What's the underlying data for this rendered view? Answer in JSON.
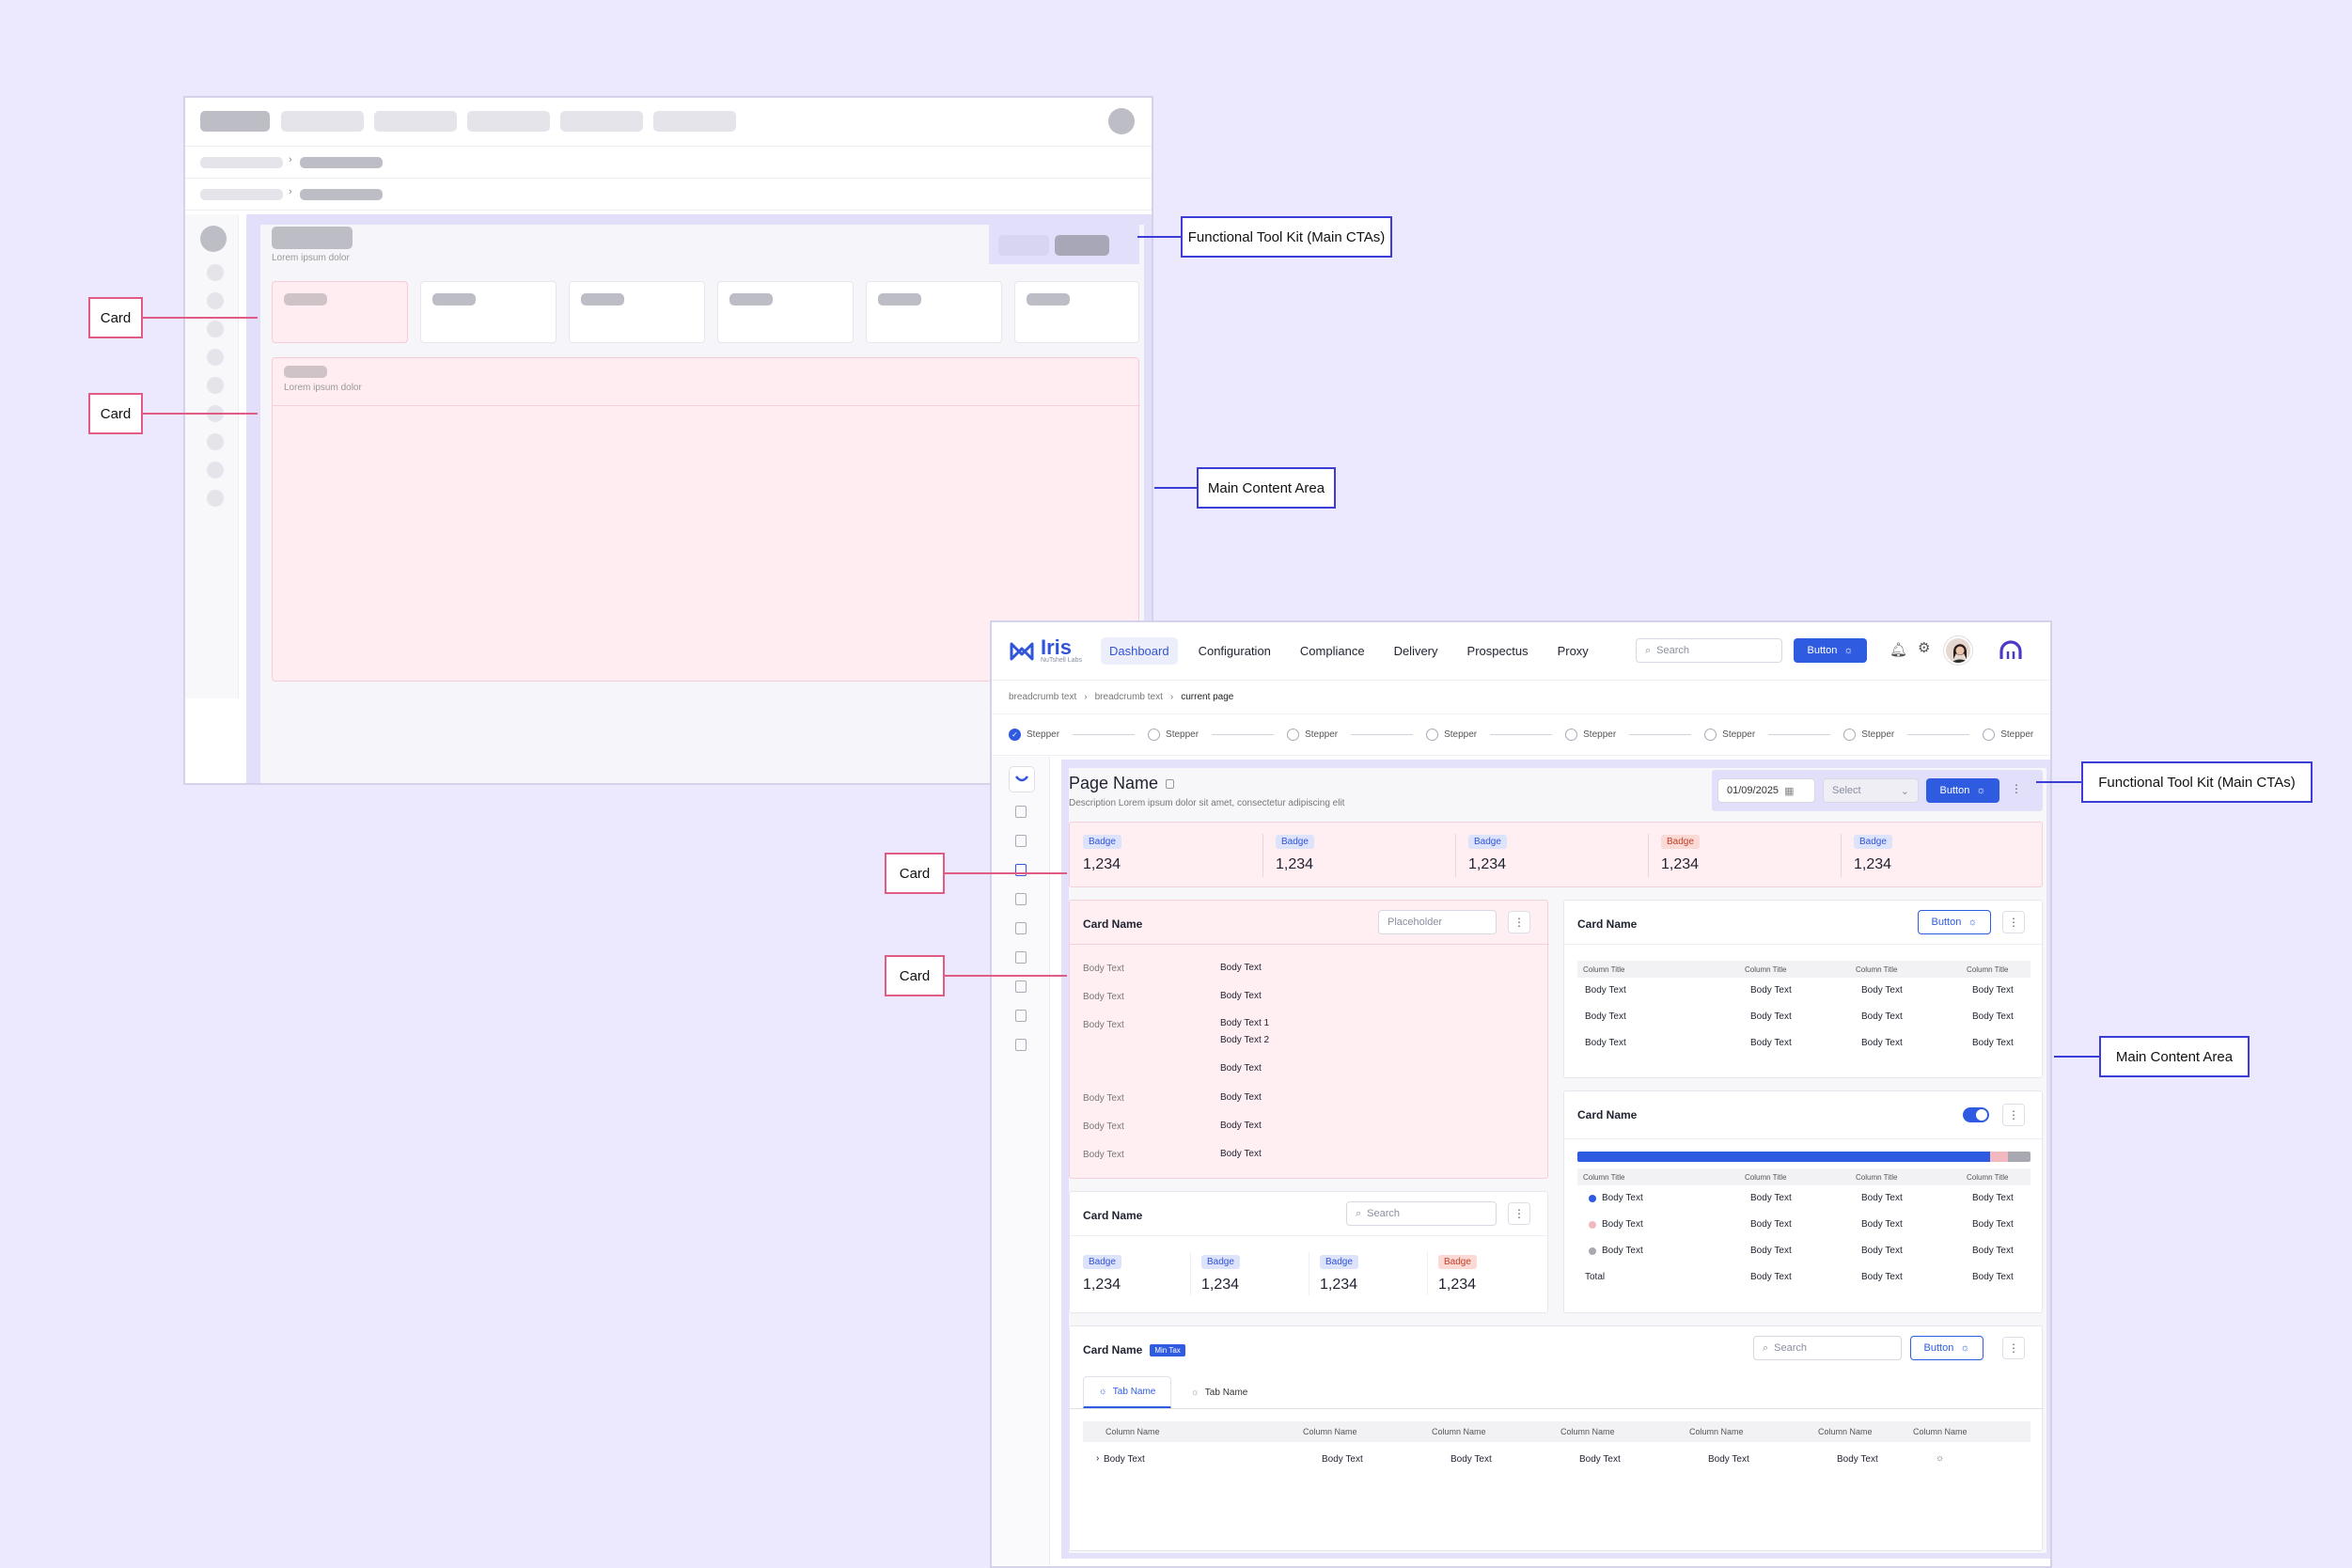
{
  "wireframe": {
    "subtitle": "Lorem ipsum dolor",
    "card_subtitle": "Lorem ipsum dolor"
  },
  "callouts": {
    "card": "Card",
    "toolkit": "Functional Tool Kit (Main CTAs)",
    "main_content": "Main Content Area"
  },
  "app": {
    "logo": {
      "name": "Iris",
      "sub": "NuTshell Labs"
    },
    "nav": [
      "Dashboard",
      "Configuration",
      "Compliance",
      "Delivery",
      "Prospectus",
      "Proxy"
    ],
    "search_placeholder": "Search",
    "nav_button": "Button",
    "breadcrumbs": [
      "breadcrumb text",
      "breadcrumb text",
      "current page"
    ],
    "steps": [
      "Stepper",
      "Stepper",
      "Stepper",
      "Stepper",
      "Stepper",
      "Stepper",
      "Stepper",
      "Stepper"
    ],
    "page_title": "Page Name",
    "page_description": "Description Lorem ipsum dolor sit amet, consectetur adipiscing elit",
    "toolkit": {
      "date": "01/09/2025",
      "select": "Select",
      "button": "Button"
    },
    "kpis": [
      {
        "badge": "Badge",
        "value": "1,234",
        "color": "blue"
      },
      {
        "badge": "Badge",
        "value": "1,234",
        "color": "blue"
      },
      {
        "badge": "Badge",
        "value": "1,234",
        "color": "blue"
      },
      {
        "badge": "Badge",
        "value": "1,234",
        "color": "red"
      },
      {
        "badge": "Badge",
        "value": "1,234",
        "color": "blue"
      }
    ],
    "card_list": {
      "title": "Card Name",
      "placeholder": "Placeholder",
      "labels": [
        "Body Text",
        "Body Text",
        "Body Text",
        "Body Text",
        "Body Text",
        "Body Text"
      ],
      "values": [
        "Body Text",
        "Body Text",
        "Body Text 1",
        "Body Text 2",
        "Body Text",
        "Body Text",
        "Body Text",
        "Body Text"
      ]
    },
    "card_table1": {
      "title": "Card Name",
      "button": "Button",
      "columns": [
        "Column Title",
        "Column Title",
        "Column Title",
        "Column Title"
      ],
      "rows": [
        [
          "Body Text",
          "Body Text",
          "Body Text",
          "Body Text"
        ],
        [
          "Body Text",
          "Body Text",
          "Body Text",
          "Body Text"
        ],
        [
          "Body Text",
          "Body Text",
          "Body Text",
          "Body Text"
        ]
      ]
    },
    "card_kpi": {
      "title": "Card Name",
      "search": "Search",
      "items": [
        {
          "badge": "Badge",
          "value": "1,234",
          "color": "blue"
        },
        {
          "badge": "Badge",
          "value": "1,234",
          "color": "blue"
        },
        {
          "badge": "Badge",
          "value": "1,234",
          "color": "blue"
        },
        {
          "badge": "Badge",
          "value": "1,234",
          "color": "red"
        }
      ]
    },
    "card_bar": {
      "title": "Card Name",
      "toggle_on": true,
      "bar_segments": [
        {
          "fraction": 0.91,
          "color": "#2F5BE0"
        },
        {
          "fraction": 0.04,
          "color": "#F2B8C0"
        },
        {
          "fraction": 0.05,
          "color": "#A8A8B0"
        }
      ],
      "columns": [
        "Column Title",
        "Column Title",
        "Column Title",
        "Column Title"
      ],
      "rows": [
        {
          "dot": "#2F5BE0",
          "cells": [
            "Body Text",
            "Body Text",
            "Body Text",
            "Body Text"
          ]
        },
        {
          "dot": "#F2B8C0",
          "cells": [
            "Body Text",
            "Body Text",
            "Body Text",
            "Body Text"
          ]
        },
        {
          "dot": "#A8A8B0",
          "cells": [
            "Body Text",
            "Body Text",
            "Body Text",
            "Body Text"
          ]
        },
        {
          "dot": "",
          "cells": [
            "Total",
            "Body Text",
            "Body Text",
            "Body Text"
          ]
        }
      ]
    },
    "card_tabs": {
      "title": "Card Name",
      "tag": "Min Tax",
      "search": "Search",
      "button": "Button",
      "tabs": [
        "Tab Name",
        "Tab Name"
      ],
      "columns": [
        "Column Name",
        "Column Name",
        "Column Name",
        "Column Name",
        "Column Name",
        "Column Name",
        "Column Name"
      ],
      "row": [
        "Body Text",
        "Body Text",
        "Body Text",
        "Body Text",
        "Body Text",
        "Body Text"
      ]
    }
  }
}
